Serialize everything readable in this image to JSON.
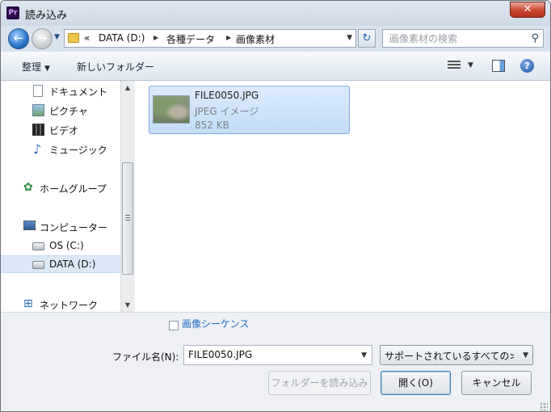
{
  "window": {
    "title": "読み込み",
    "app_icon": "Pr"
  },
  "address": {
    "overflow": "«",
    "crumbs": [
      "DATA (D:)",
      "各種データ",
      "画像素材"
    ]
  },
  "search": {
    "placeholder": "画像素材の検索"
  },
  "toolbar": {
    "organize": "整理",
    "new_folder": "新しいフォルダー"
  },
  "nav": {
    "items": [
      {
        "label": "ドキュメント",
        "icon": "document-icon"
      },
      {
        "label": "ピクチャ",
        "icon": "pictures-icon"
      },
      {
        "label": "ビデオ",
        "icon": "video-icon"
      },
      {
        "label": "ミュージック",
        "icon": "music-icon"
      },
      {
        "label": "ホームグループ",
        "icon": "homegroup-icon"
      },
      {
        "label": "コンピューター",
        "icon": "computer-icon"
      },
      {
        "label": "OS (C:)",
        "icon": "drive-icon"
      },
      {
        "label": "DATA (D:)",
        "icon": "drive-icon"
      },
      {
        "label": "ネットワーク",
        "icon": "network-icon"
      }
    ],
    "selected": "DATA (D:)"
  },
  "files": [
    {
      "name": "FILE0050.JPG",
      "type": "JPEG イメージ",
      "size": "852 KB"
    }
  ],
  "bottom": {
    "sequence_label": "画像シーケンス",
    "sequence_checked": false,
    "filename_label": "ファイル名(N):",
    "filename_value": "FILE0050.JPG",
    "filetype_value": "サポートされているすべての>",
    "import_folder": "フォルダーを読み込み",
    "open": "開く(O)",
    "cancel": "キャンセル"
  },
  "colors": {
    "selection": "#c3dcf7",
    "link": "#1c6bc4",
    "close": "#c7452f"
  }
}
